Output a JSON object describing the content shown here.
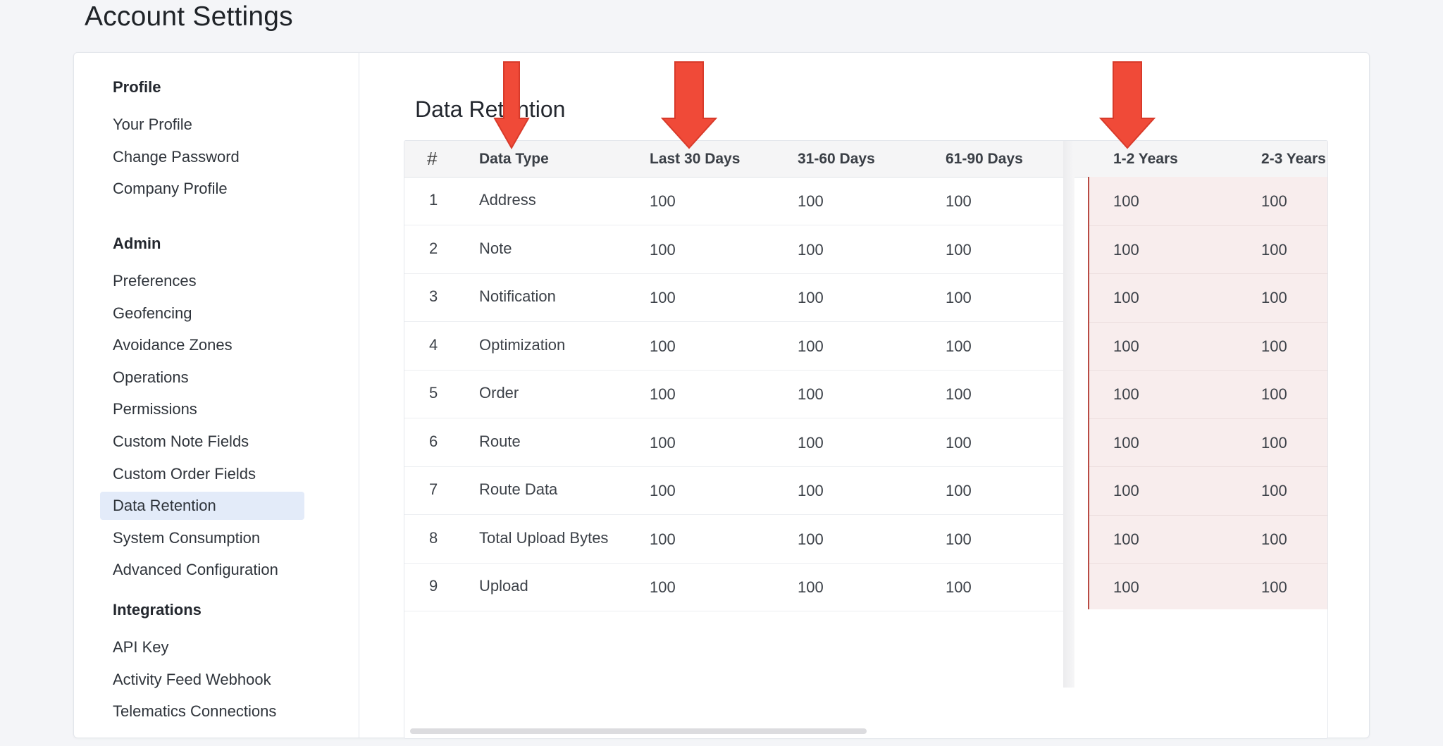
{
  "page": {
    "title": "Account Settings"
  },
  "sidebar": {
    "sections": [
      {
        "title": "Profile",
        "items": [
          "Your Profile",
          "Change Password",
          "Company Profile"
        ]
      },
      {
        "title": "Admin",
        "items": [
          "Preferences",
          "Geofencing",
          "Avoidance Zones",
          "Operations",
          "Permissions",
          "Custom Note Fields",
          "Custom Order Fields",
          "Data Retention",
          "System Consumption",
          "Advanced Configuration"
        ]
      },
      {
        "title": "Integrations",
        "items": [
          "API Key",
          "Activity Feed Webhook",
          "Telematics Connections"
        ]
      }
    ],
    "active_item": "Data Retention"
  },
  "content": {
    "title": "Data Retention",
    "table": {
      "headers": [
        "#",
        "Data Type",
        "Last 30 Days",
        "31-60 Days",
        "61-90 Days",
        "1-2 Years",
        "2-3 Years"
      ],
      "rows": [
        [
          "1",
          "Address",
          "100",
          "100",
          "100",
          "100",
          "100"
        ],
        [
          "2",
          "Note",
          "100",
          "100",
          "100",
          "100",
          "100"
        ],
        [
          "3",
          "Notification",
          "100",
          "100",
          "100",
          "100",
          "100"
        ],
        [
          "4",
          "Optimization",
          "100",
          "100",
          "100",
          "100",
          "100"
        ],
        [
          "5",
          "Order",
          "100",
          "100",
          "100",
          "100",
          "100"
        ],
        [
          "6",
          "Route",
          "100",
          "100",
          "100",
          "100",
          "100"
        ],
        [
          "7",
          "Route Data",
          "100",
          "100",
          "100",
          "100",
          "100"
        ],
        [
          "8",
          "Total Upload Bytes",
          "100",
          "100",
          "100",
          "100",
          "100"
        ],
        [
          "9",
          "Upload",
          "100",
          "100",
          "100",
          "100",
          "100"
        ]
      ]
    }
  },
  "annotations": {
    "arrow_color": "#f04a38",
    "arrow_icon": "down-arrow-icon"
  },
  "colors": {
    "active_nav_bg": "#e3ebf9",
    "pinned_bg": "#f8eded",
    "pinned_divider": "#b84a43"
  }
}
